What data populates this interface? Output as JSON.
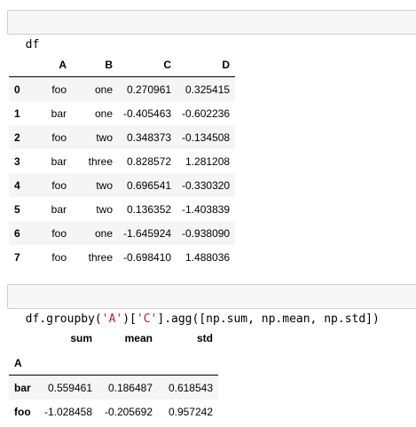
{
  "cells": {
    "cell1": {
      "code": "df"
    },
    "cell2": {
      "tokens": [
        {
          "t": "df.groupby(",
          "c": "op"
        },
        {
          "t": "'A'",
          "c": "str"
        },
        {
          "t": ")[",
          "c": "op"
        },
        {
          "t": "'C'",
          "c": "str"
        },
        {
          "t": "].agg([np.sum, np.mean, np.std])",
          "c": "op"
        }
      ]
    }
  },
  "df": {
    "columns": [
      "A",
      "B",
      "C",
      "D"
    ],
    "rows": [
      {
        "idx": "0",
        "A": "foo",
        "B": "one",
        "C": "0.270961",
        "D": "0.325415"
      },
      {
        "idx": "1",
        "A": "bar",
        "B": "one",
        "C": "-0.405463",
        "D": "-0.602236"
      },
      {
        "idx": "2",
        "A": "foo",
        "B": "two",
        "C": "0.348373",
        "D": "-0.134508"
      },
      {
        "idx": "3",
        "A": "bar",
        "B": "three",
        "C": "0.828572",
        "D": "1.281208"
      },
      {
        "idx": "4",
        "A": "foo",
        "B": "two",
        "C": "0.696541",
        "D": "-0.330320"
      },
      {
        "idx": "5",
        "A": "bar",
        "B": "two",
        "C": "0.136352",
        "D": "-1.403839"
      },
      {
        "idx": "6",
        "A": "foo",
        "B": "one",
        "C": "-1.645924",
        "D": "-0.938090"
      },
      {
        "idx": "7",
        "A": "foo",
        "B": "three",
        "C": "-0.698410",
        "D": "1.488036"
      }
    ]
  },
  "agg": {
    "columns": [
      "sum",
      "mean",
      "std"
    ],
    "index_name": "A",
    "rows": [
      {
        "idx": "bar",
        "sum": "0.559461",
        "mean": "0.186487",
        "std": "0.618543"
      },
      {
        "idx": "foo",
        "sum": "-1.028458",
        "mean": "-0.205692",
        "std": "0.957242"
      }
    ]
  }
}
